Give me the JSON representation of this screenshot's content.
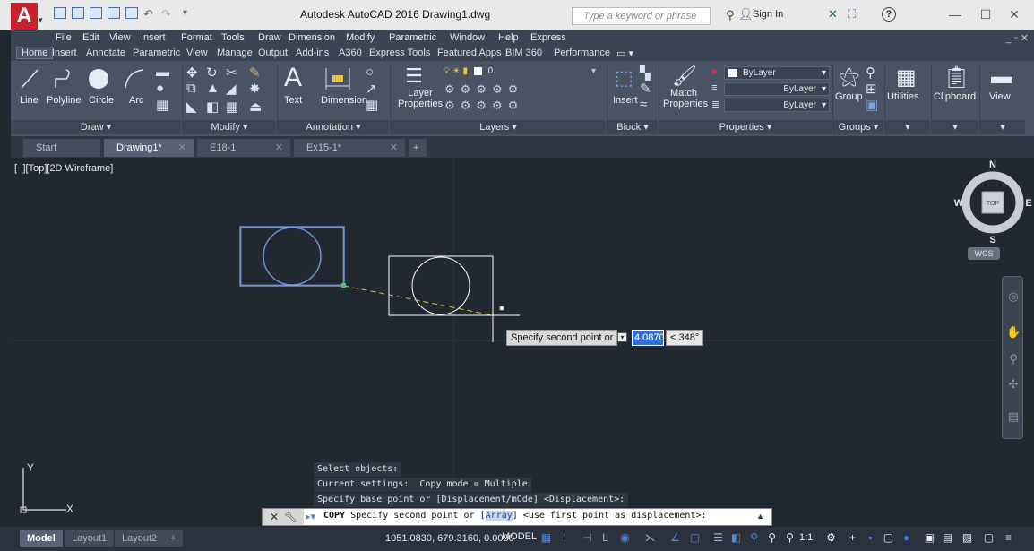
{
  "titlebar": {
    "title": "Autodesk AutoCAD 2016    Drawing1.dwg",
    "logo": "A",
    "search_placeholder": "Type a keyword or phrase",
    "sign_in": "Sign In"
  },
  "menubar": {
    "items": [
      "File",
      "Edit",
      "View",
      "Insert",
      "Format",
      "Tools",
      "Draw",
      "Dimension",
      "Modify",
      "Parametric",
      "Window",
      "Help",
      "Express"
    ]
  },
  "ribbon_tabs": {
    "items": [
      "Home",
      "Insert",
      "Annotate",
      "Parametric",
      "View",
      "Manage",
      "Output",
      "Add-ins",
      "A360",
      "Express Tools",
      "Featured Apps",
      "BIM 360",
      "Performance"
    ],
    "active": "Home"
  },
  "ribbon": {
    "draw": {
      "line": "Line",
      "polyline": "Polyline",
      "circle": "Circle",
      "arc": "Arc",
      "footer": "Draw ▾"
    },
    "modify": {
      "footer": "Modify ▾"
    },
    "annotation": {
      "text": "Text",
      "dimension": "Dimension",
      "footer": "Annotation ▾"
    },
    "layers": {
      "layer_properties": "Layer Properties",
      "current_layer": "0",
      "footer": "Layers ▾"
    },
    "block": {
      "insert": "Insert",
      "footer": "Block ▾"
    },
    "properties": {
      "match": "Match Properties",
      "color": "ByLayer",
      "linetype": "ByLayer",
      "lineweight": "ByLayer",
      "footer": "Properties ▾"
    },
    "groups": {
      "group": "Group",
      "footer": "Groups ▾"
    },
    "utilities": {
      "label": "Utilities"
    },
    "clipboard": {
      "label": "Clipboard"
    },
    "view": {
      "label": "View"
    }
  },
  "doc_tabs": {
    "items": [
      "Start",
      "Drawing1*",
      "E18-1",
      "Ex15-1*"
    ],
    "active": "Drawing1*",
    "add": "+"
  },
  "viewport": {
    "label": "[−][Top][2D Wireframe]"
  },
  "viewcube": {
    "north": "N",
    "south": "S",
    "east": "E",
    "west": "W",
    "face": "TOP",
    "wcs": "WCS"
  },
  "dynamic_input": {
    "prompt": "Specify second point or",
    "distance": "4.0870",
    "angle": "< 348°"
  },
  "command_history": [
    "Select objects:",
    "Current settings:  Copy mode = Multiple",
    "Specify base point or [Displacement/mOde] <Displacement>:"
  ],
  "command_line": {
    "command": "COPY",
    "prompt_before": " Specify second point or [",
    "option": "Array",
    "prompt_after": "] <use first point as displacement>:"
  },
  "ucs": {
    "x": "X",
    "y": "Y"
  },
  "statusbar": {
    "layout_tabs": [
      "Model",
      "Layout1",
      "Layout2"
    ],
    "active_tab": "Model",
    "add": "+",
    "coordinates": "1051.0830, 679.3160, 0.0000",
    "space": "MODEL",
    "scale": "1:1"
  },
  "colors": {
    "background": "#212830",
    "selected_block": "#6f90d6",
    "preview_white": "#ffffff",
    "rubberband": "#d9c23a",
    "app_red": "#c8202c"
  }
}
